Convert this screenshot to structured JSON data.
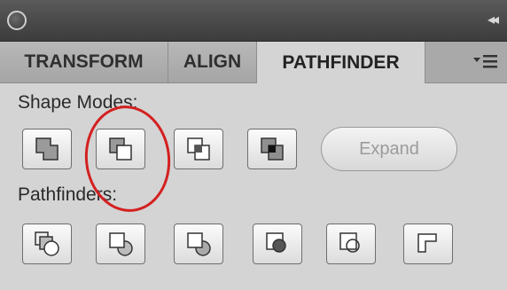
{
  "panel": {
    "tabs": [
      {
        "label": "TRANSFORM",
        "active": false
      },
      {
        "label": "ALIGN",
        "active": false
      },
      {
        "label": "PATHFINDER",
        "active": true
      }
    ]
  },
  "shape_modes": {
    "label": "Shape Modes:",
    "buttons": [
      "unite-icon",
      "minus-front-icon",
      "intersect-icon",
      "exclude-icon"
    ],
    "expand_label": "Expand"
  },
  "pathfinders": {
    "label": "Pathfinders:",
    "buttons": [
      "divide-icon",
      "trim-icon",
      "merge-icon",
      "crop-icon",
      "outline-icon",
      "minus-back-icon"
    ]
  },
  "annotation": {
    "color": "#d42020"
  }
}
